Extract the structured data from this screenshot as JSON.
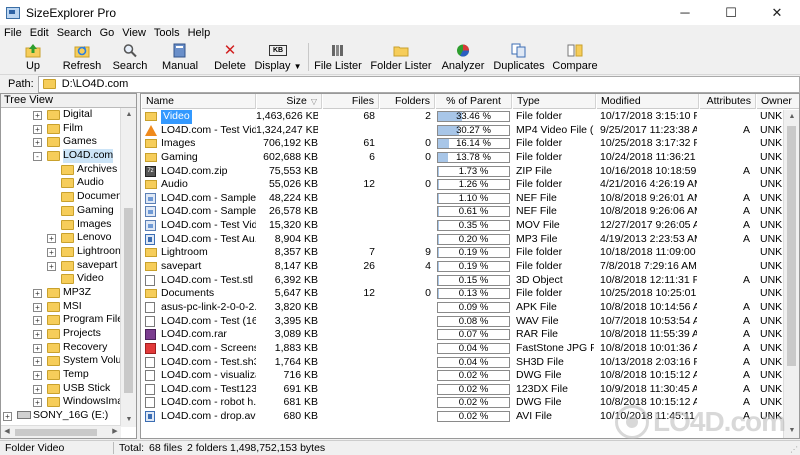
{
  "window": {
    "title": "SizeExplorer Pro",
    "minimize": "─",
    "maximize": "☐",
    "close": "✕"
  },
  "menu": [
    "File",
    "Edit",
    "Search",
    "Go",
    "View",
    "Tools",
    "Help"
  ],
  "toolbar": {
    "up": "Up",
    "refresh": "Refresh",
    "search": "Search",
    "manual": "Manual",
    "delete": "Delete",
    "display": "Display",
    "display_icon_text": "KB",
    "file_lister": "File Lister",
    "folder_lister": "Folder Lister",
    "analyzer": "Analyzer",
    "duplicates": "Duplicates",
    "compare": "Compare"
  },
  "path": {
    "label": "Path:",
    "value": "D:\\LO4D.com"
  },
  "tree": {
    "header": "Tree View",
    "items": [
      {
        "label": "Digital",
        "level": 1,
        "expander": "+"
      },
      {
        "label": "Film",
        "level": 1,
        "expander": "+"
      },
      {
        "label": "Games",
        "level": 1,
        "expander": "+"
      },
      {
        "label": "LO4D.com",
        "level": 1,
        "expander": "-",
        "selected": true
      },
      {
        "label": "Archives",
        "level": 2,
        "expander": ""
      },
      {
        "label": "Audio",
        "level": 2,
        "expander": ""
      },
      {
        "label": "Documen",
        "level": 2,
        "expander": ""
      },
      {
        "label": "Gaming",
        "level": 2,
        "expander": ""
      },
      {
        "label": "Images",
        "level": 2,
        "expander": ""
      },
      {
        "label": "Lenovo",
        "level": 2,
        "expander": "+"
      },
      {
        "label": "Lightroon",
        "level": 2,
        "expander": "+"
      },
      {
        "label": "savepart",
        "level": 2,
        "expander": "+"
      },
      {
        "label": "Video",
        "level": 2,
        "expander": ""
      },
      {
        "label": "MP3Z",
        "level": 1,
        "expander": "+"
      },
      {
        "label": "MSI",
        "level": 1,
        "expander": "+"
      },
      {
        "label": "Program Files",
        "level": 1,
        "expander": "+"
      },
      {
        "label": "Projects",
        "level": 1,
        "expander": "+"
      },
      {
        "label": "Recovery",
        "level": 1,
        "expander": "+"
      },
      {
        "label": "System Volum",
        "level": 1,
        "expander": "+"
      },
      {
        "label": "Temp",
        "level": 1,
        "expander": "+"
      },
      {
        "label": "USB Stick",
        "level": 1,
        "expander": "+"
      },
      {
        "label": "WindowsImag",
        "level": 1,
        "expander": "+"
      },
      {
        "label": "SONY_16G (E:)",
        "level": 0,
        "expander": "+",
        "drive": true
      }
    ]
  },
  "columns": [
    "Name",
    "Size",
    "Files",
    "Folders",
    "% of Parent",
    "Type",
    "Modified",
    "Attributes",
    "Owner"
  ],
  "sort_indicator": "▽",
  "rows": [
    {
      "name": "Video",
      "size": "1,463,626 KB",
      "files": "68",
      "folders": "2",
      "pct": 33.46,
      "pct_label": "33.46 %",
      "type": "File folder",
      "modified": "10/17/2018 3:15:10 PM",
      "attr": "",
      "owner": "UNKN",
      "icon": "folder",
      "selected": true
    },
    {
      "name": "LO4D.com - Test Vid...",
      "size": "1,324,247 KB",
      "files": "",
      "folders": "",
      "pct": 30.27,
      "pct_label": "30.27 %",
      "type": "MP4 Video File (...",
      "modified": "9/25/2017 11:23:38 AM",
      "attr": "A",
      "owner": "UNKN",
      "icon": "vlc"
    },
    {
      "name": "Images",
      "size": "706,192 KB",
      "files": "61",
      "folders": "0",
      "pct": 16.14,
      "pct_label": "16.14 %",
      "type": "File folder",
      "modified": "10/25/2018 3:17:32 PM",
      "attr": "",
      "owner": "UNKN",
      "icon": "folder"
    },
    {
      "name": "Gaming",
      "size": "602,688 KB",
      "files": "6",
      "folders": "0",
      "pct": 13.78,
      "pct_label": "13.78 %",
      "type": "File folder",
      "modified": "10/24/2018 11:36:21 AM",
      "attr": "",
      "owner": "UNKN",
      "icon": "folder"
    },
    {
      "name": "LO4D.com.zip",
      "size": "75,553 KB",
      "files": "",
      "folders": "",
      "pct": 1.73,
      "pct_label": "1.73 %",
      "type": "ZIP File",
      "modified": "10/16/2018 10:18:59 PM",
      "attr": "A",
      "owner": "UNKN",
      "icon": "zip"
    },
    {
      "name": "Audio",
      "size": "55,026 KB",
      "files": "12",
      "folders": "0",
      "pct": 1.26,
      "pct_label": "1.26 %",
      "type": "File folder",
      "modified": "4/21/2016 4:26:19 AM",
      "attr": "",
      "owner": "UNKN",
      "icon": "folder"
    },
    {
      "name": "LO4D.com - Sample ...",
      "size": "48,224 KB",
      "files": "",
      "folders": "",
      "pct": 1.1,
      "pct_label": "1.10 %",
      "type": "NEF File",
      "modified": "10/8/2018 9:26:01 AM",
      "attr": "A",
      "owner": "UNKN",
      "icon": "img"
    },
    {
      "name": "LO4D.com - Sample ...",
      "size": "26,578 KB",
      "files": "",
      "folders": "",
      "pct": 0.61,
      "pct_label": "0.61 %",
      "type": "NEF File",
      "modified": "10/8/2018 9:26:06 AM",
      "attr": "A",
      "owner": "UNKN",
      "icon": "img"
    },
    {
      "name": "LO4D.com - Test Vid...",
      "size": "15,320 KB",
      "files": "",
      "folders": "",
      "pct": 0.35,
      "pct_label": "0.35 %",
      "type": "MOV File",
      "modified": "12/27/2017 9:26:05 AM",
      "attr": "A",
      "owner": "UNKN",
      "icon": "img"
    },
    {
      "name": "LO4D.com - Test Au...",
      "size": "8,904 KB",
      "files": "",
      "folders": "",
      "pct": 0.2,
      "pct_label": "0.20 %",
      "type": "MP3 File",
      "modified": "4/19/2013 2:23:53 AM",
      "attr": "A",
      "owner": "UNKN",
      "icon": "blue"
    },
    {
      "name": "Lightroom",
      "size": "8,357 KB",
      "files": "7",
      "folders": "9",
      "pct": 0.19,
      "pct_label": "0.19 %",
      "type": "File folder",
      "modified": "10/18/2018 11:09:00 P",
      "attr": "",
      "owner": "UNKN",
      "icon": "folder"
    },
    {
      "name": "savepart",
      "size": "8,147 KB",
      "files": "26",
      "folders": "4",
      "pct": 0.19,
      "pct_label": "0.19 %",
      "type": "File folder",
      "modified": "7/8/2018 7:29:16 AM",
      "attr": "",
      "owner": "UNKN",
      "icon": "folder"
    },
    {
      "name": "LO4D.com - Test.stl",
      "size": "6,392 KB",
      "files": "",
      "folders": "",
      "pct": 0.15,
      "pct_label": "0.15 %",
      "type": "3D Object",
      "modified": "10/8/2018 12:11:31 PM",
      "attr": "A",
      "owner": "UNKN",
      "icon": "doc"
    },
    {
      "name": "Documents",
      "size": "5,647 KB",
      "files": "12",
      "folders": "0",
      "pct": 0.13,
      "pct_label": "0.13 %",
      "type": "File folder",
      "modified": "10/25/2018 10:25:01 AM",
      "attr": "",
      "owner": "UNKN",
      "icon": "folder"
    },
    {
      "name": "asus-pc-link-2-0-0-2...",
      "size": "3,820 KB",
      "files": "",
      "folders": "",
      "pct": 0.09,
      "pct_label": "0.09 %",
      "type": "APK File",
      "modified": "10/8/2018 10:14:56 AM",
      "attr": "A",
      "owner": "UNKN",
      "icon": "doc"
    },
    {
      "name": "LO4D.com - Test (16...",
      "size": "3,395 KB",
      "files": "",
      "folders": "",
      "pct": 0.08,
      "pct_label": "0.08 %",
      "type": "WAV File",
      "modified": "10/7/2018 10:53:54 AM",
      "attr": "A",
      "owner": "UNKN",
      "icon": "doc"
    },
    {
      "name": "LO4D.com.rar",
      "size": "3,089 KB",
      "files": "",
      "folders": "",
      "pct": 0.07,
      "pct_label": "0.07 %",
      "type": "RAR File",
      "modified": "10/8/2018 11:55:39 AM",
      "attr": "A",
      "owner": "UNKN",
      "icon": "rar"
    },
    {
      "name": "LO4D.com - Screens...",
      "size": "1,883 KB",
      "files": "",
      "folders": "",
      "pct": 0.04,
      "pct_label": "0.04 %",
      "type": "FastStone JPG File",
      "modified": "10/8/2018 10:01:36 AM",
      "attr": "A",
      "owner": "UNKN",
      "icon": "fs"
    },
    {
      "name": "LO4D.com - Test.sh3d",
      "size": "1,764 KB",
      "files": "",
      "folders": "",
      "pct": 0.04,
      "pct_label": "0.04 %",
      "type": "SH3D File",
      "modified": "10/13/2018 2:03:16 PM",
      "attr": "A",
      "owner": "UNKN",
      "icon": "doc"
    },
    {
      "name": "LO4D.com - visualiza...",
      "size": "716 KB",
      "files": "",
      "folders": "",
      "pct": 0.02,
      "pct_label": "0.02 %",
      "type": "DWG File",
      "modified": "10/8/2018 10:15:12 AM",
      "attr": "A",
      "owner": "UNKN",
      "icon": "doc"
    },
    {
      "name": "LO4D.com - Test123...",
      "size": "691 KB",
      "files": "",
      "folders": "",
      "pct": 0.02,
      "pct_label": "0.02 %",
      "type": "123DX File",
      "modified": "10/9/2018 11:30:45 AM",
      "attr": "A",
      "owner": "UNKN",
      "icon": "doc"
    },
    {
      "name": "LO4D.com - robot h...",
      "size": "681 KB",
      "files": "",
      "folders": "",
      "pct": 0.02,
      "pct_label": "0.02 %",
      "type": "DWG File",
      "modified": "10/8/2018 10:15:12 AM",
      "attr": "A",
      "owner": "UNKN",
      "icon": "doc"
    },
    {
      "name": "LO4D.com - drop.avi",
      "size": "680 KB",
      "files": "",
      "folders": "",
      "pct": 0.02,
      "pct_label": "0.02 %",
      "type": "AVI File",
      "modified": "10/10/2018 11:45:11 AM",
      "attr": "A",
      "owner": "UNKN",
      "icon": "blue"
    }
  ],
  "status": {
    "folder": "Folder Video",
    "total_label": "Total:",
    "files": "68 files",
    "folders": "2 folders",
    "bytes": "1,498,752,153 bytes"
  },
  "watermark": "LO4D.com",
  "colors": {
    "selection": "#3399ff",
    "bar_fill": "#a8c6e8",
    "folder": "#f6cd5a"
  }
}
